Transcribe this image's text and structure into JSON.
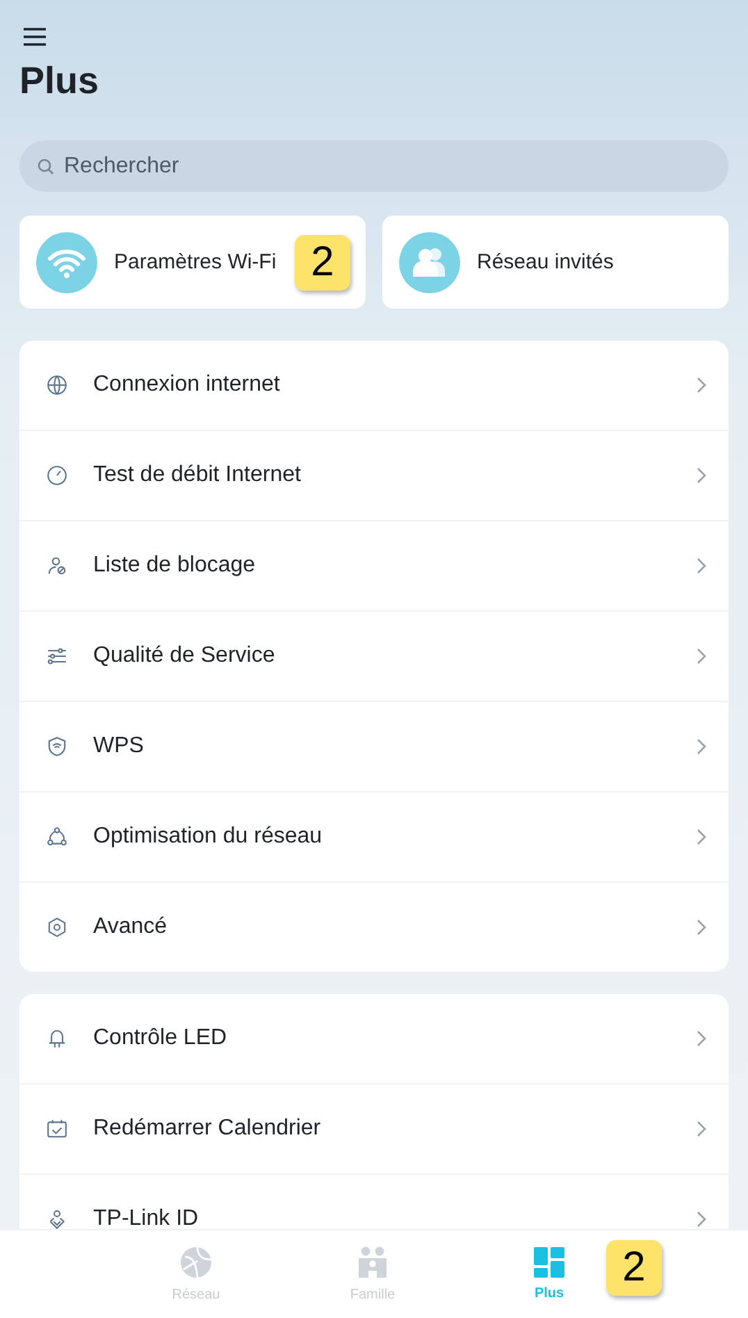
{
  "header": {
    "title": "Plus"
  },
  "search": {
    "placeholder": "Rechercher"
  },
  "shortcuts": [
    {
      "label": "Paramètres Wi-Fi",
      "marker": "2"
    },
    {
      "label": "Réseau invités"
    }
  ],
  "groups": [
    {
      "items": [
        "Connexion internet",
        "Test de débit Internet",
        "Liste de blocage",
        "Qualité de Service",
        "WPS",
        "Optimisation du réseau",
        "Avancé"
      ]
    },
    {
      "items": [
        "Contrôle LED",
        "Redémarrer Calendrier",
        "TP-Link ID"
      ]
    }
  ],
  "tab_bar": {
    "tabs": [
      {
        "label": "Réseau",
        "selected": false
      },
      {
        "label": "Famille",
        "selected": false
      },
      {
        "label": "Plus",
        "selected": true
      }
    ],
    "marker": "2"
  }
}
